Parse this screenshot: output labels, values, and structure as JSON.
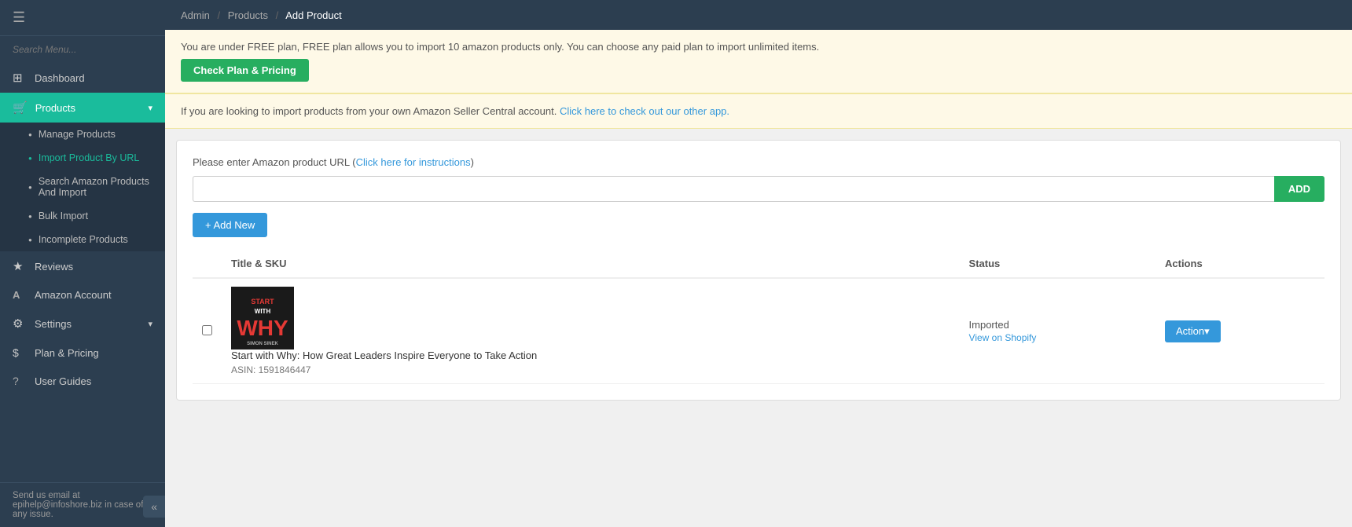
{
  "sidebar": {
    "hamburger_icon": "☰",
    "search_placeholder": "Search Menu...",
    "items": [
      {
        "id": "dashboard",
        "label": "Dashboard",
        "icon": "⊞",
        "active": false
      },
      {
        "id": "products",
        "label": "Products",
        "icon": "🛒",
        "active": true,
        "has_chevron": true
      },
      {
        "id": "reviews",
        "label": "Reviews",
        "icon": "★",
        "active": false
      },
      {
        "id": "amazon-account",
        "label": "Amazon Account",
        "icon": "Ⓐ",
        "active": false
      },
      {
        "id": "settings",
        "label": "Settings",
        "icon": "⚙",
        "active": false,
        "has_chevron": true
      },
      {
        "id": "plan-pricing",
        "label": "Plan & Pricing",
        "icon": "$",
        "active": false
      },
      {
        "id": "user-guides",
        "label": "User Guides",
        "icon": "?",
        "active": false
      }
    ],
    "products_sub_items": [
      {
        "id": "manage-products",
        "label": "Manage Products"
      },
      {
        "id": "import-product-by-url",
        "label": "Import Product By URL",
        "active": true
      },
      {
        "id": "search-amazon",
        "label": "Search Amazon Products And Import"
      },
      {
        "id": "bulk-import",
        "label": "Bulk Import"
      },
      {
        "id": "incomplete-products",
        "label": "Incomplete Products"
      }
    ],
    "bottom_text": "Send us email at epihelp@infoshore.biz in case of any issue.",
    "collapse_icon": "«"
  },
  "topbar": {
    "admin_label": "Admin",
    "sep1": "/",
    "products_label": "Products",
    "sep2": "/",
    "current_label": "Add Product"
  },
  "alerts": {
    "free_plan_message": "You are under FREE plan, FREE plan allows you to import 10 amazon products only. You can choose any paid plan to import unlimited items.",
    "check_plan_btn": "Check Plan & Pricing",
    "seller_central_message": "If you are looking to import products from your own Amazon Seller Central account. ",
    "seller_central_link": "Click here to check out our other app."
  },
  "url_section": {
    "label": "Please enter Amazon product URL (",
    "instructions_link": "Click here for instructions",
    "label_end": ")",
    "input_placeholder": "",
    "add_btn": "ADD"
  },
  "add_new_btn": "+ Add New",
  "table": {
    "columns": [
      "",
      "Title & SKU",
      "Status",
      "Actions"
    ],
    "rows": [
      {
        "title": "Start with Why: How Great Leaders Inspire Everyone to Take Action",
        "asin": "ASIN: 1591846447",
        "status": "Imported",
        "status_link": "View on Shopify",
        "action_btn": "Action▾"
      }
    ]
  }
}
